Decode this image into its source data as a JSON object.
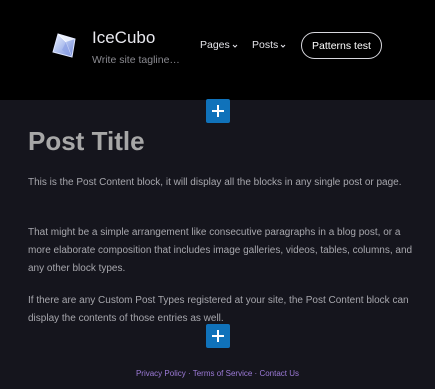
{
  "header": {
    "site_title": "IceCubo",
    "site_tagline": "Write site tagline…",
    "logo_icon": "ice-cube-icon",
    "nav": {
      "pages_label": "Pages",
      "posts_label": "Posts",
      "button_label": "Patterns test"
    }
  },
  "editor": {
    "inserter_icon": "plus-icon",
    "accent_color": "#1072ba"
  },
  "post": {
    "title": "Post Title",
    "paragraphs": [
      "This is the Post Content block, it will display all the blocks in any single post or page.",
      "That might be a simple arrangement like consecutive paragraphs in a blog post, or a more elaborate composition that includes image galleries, videos, tables, columns, and any other block types.",
      "If there are any Custom Post Types registered at your site, the Post Content block can display the contents of those entries as well."
    ]
  },
  "footer": {
    "links": [
      "Privacy Policy",
      "Terms of Service",
      "Contact Us"
    ],
    "separator": "·",
    "link_color": "#9d7bd8"
  }
}
